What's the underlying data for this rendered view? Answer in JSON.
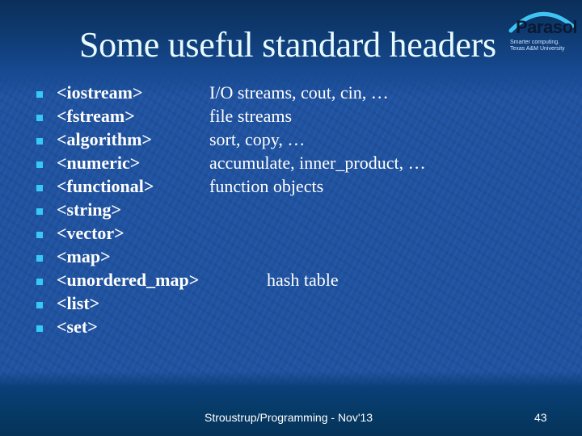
{
  "slide": {
    "title": "Some useful standard headers",
    "logo": {
      "name": "Parasol",
      "tagline_1": "Smarter computing.",
      "tagline_2": "Texas A&M University"
    },
    "items": [
      {
        "header": "<iostream>",
        "description": "I/O streams, cout, cin, …"
      },
      {
        "header": "<fstream>",
        "description": "file streams"
      },
      {
        "header": "<algorithm>",
        "description": "sort, copy, …"
      },
      {
        "header": "<numeric>",
        "description": "accumulate, inner_product, …"
      },
      {
        "header": "<functional>",
        "description": "function objects"
      },
      {
        "header": "<string>",
        "description": ""
      },
      {
        "header": "<vector>",
        "description": ""
      },
      {
        "header": "<map>",
        "description": ""
      },
      {
        "header": "<unordered_map>",
        "description": "hash table"
      },
      {
        "header": "<list>",
        "description": ""
      },
      {
        "header": "<set>",
        "description": ""
      }
    ],
    "footer": "Stroustrup/Programming - Nov'13",
    "page_number": "43",
    "colors": {
      "background": "#1f52a0",
      "bullet": "#38c8f8",
      "title": "#e8fbff",
      "text": "#ffffff"
    }
  }
}
